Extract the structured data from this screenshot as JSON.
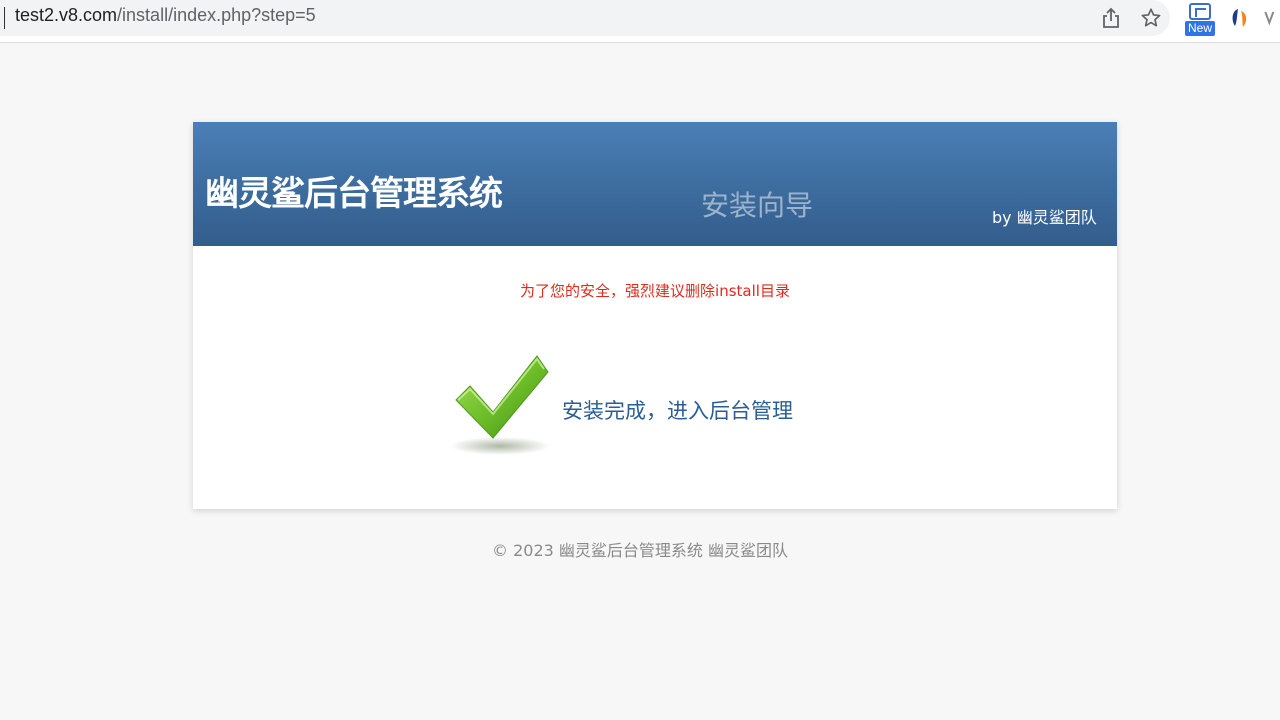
{
  "browser": {
    "url_host": "test2.v8.com",
    "url_path": "/install/index.php?step=5",
    "extension_badge": "New"
  },
  "header": {
    "system_title": "幽灵鲨后台管理系统",
    "wizard_title": "安装向导",
    "by_team": "by 幽灵鲨团队"
  },
  "main": {
    "security_note": "为了您的安全，强烈建议删除install目录",
    "done_link": "安装完成，进入后台管理"
  },
  "footer": {
    "copyright": "© 2023 幽灵鲨后台管理系统 幽灵鲨团队"
  },
  "colors": {
    "header_bg": "#3b6a9c",
    "warning": "#e02b1b",
    "link": "#2b5e94",
    "check_green": "#6fbf2a"
  },
  "icons": [
    "share-icon",
    "star-icon",
    "extension-new-icon",
    "extension-logo-icon",
    "extension-v-icon",
    "check-icon"
  ]
}
